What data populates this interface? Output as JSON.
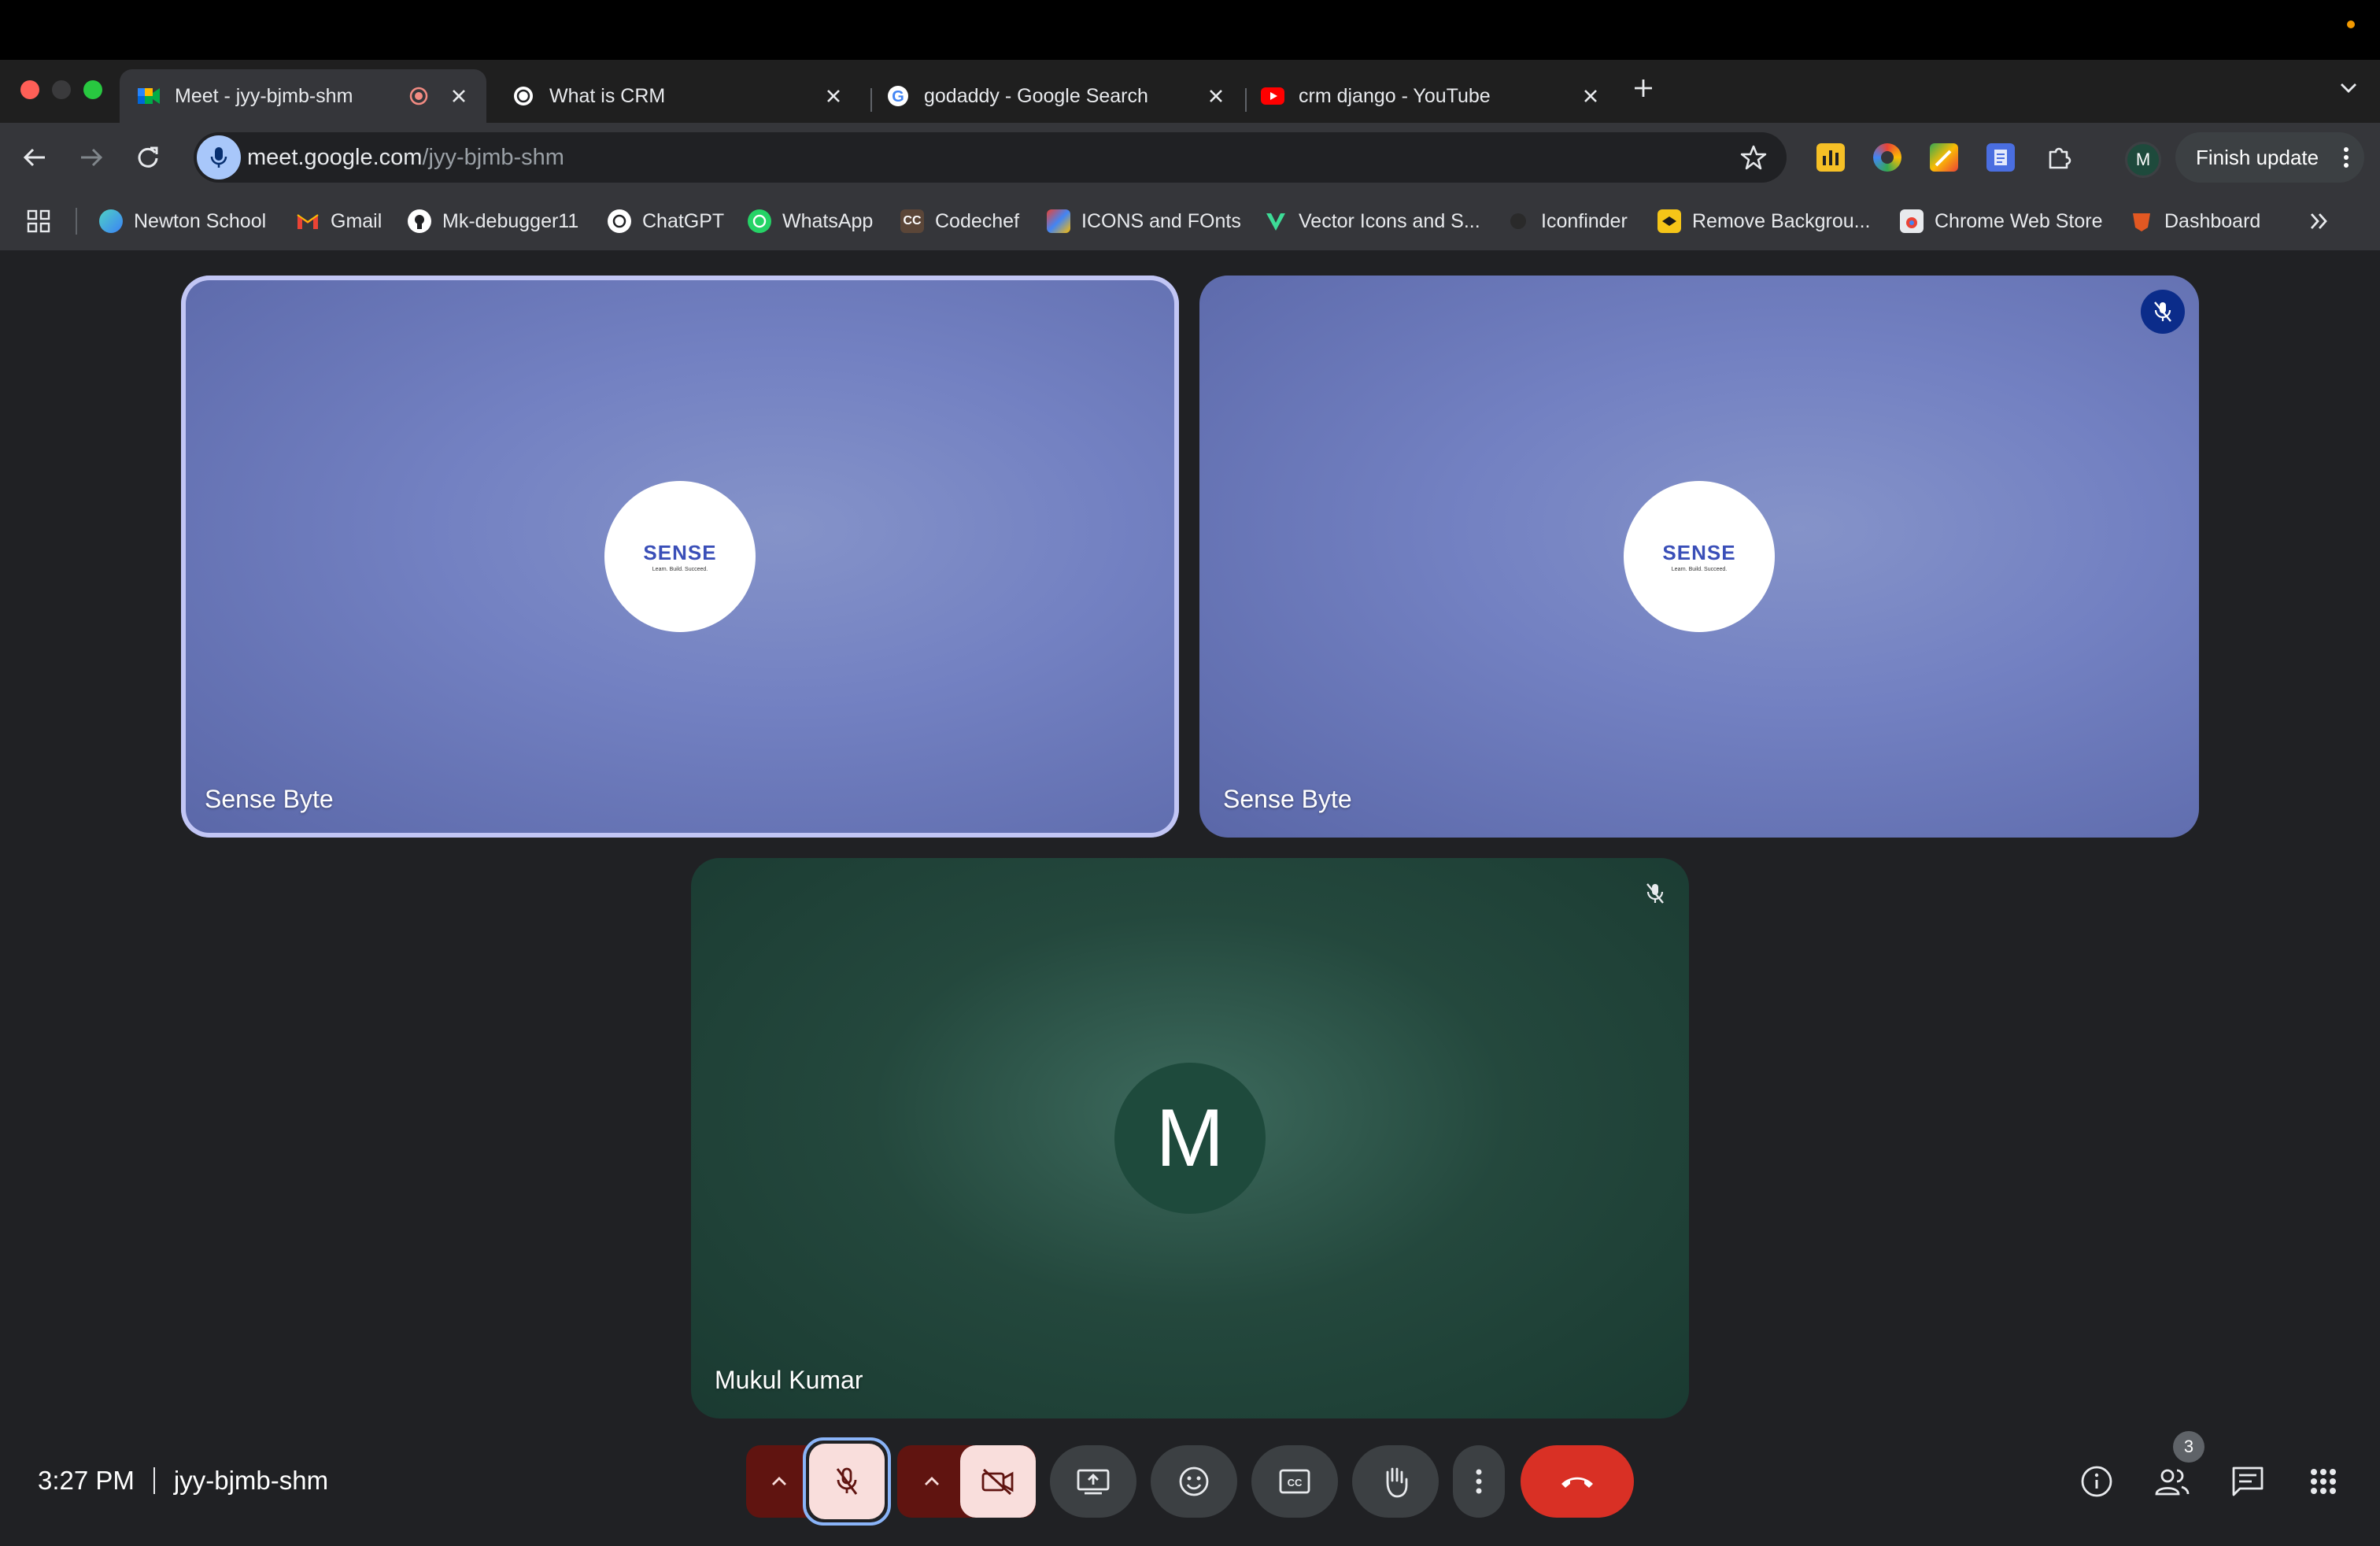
{
  "browser": {
    "tabs": [
      {
        "title": "Meet - jyy-bjmb-shm",
        "favicon": "google-meet-icon",
        "active": true,
        "recording": true
      },
      {
        "title": "What is CRM",
        "favicon": "chatgpt-icon",
        "active": false
      },
      {
        "title": "godaddy - Google Search",
        "favicon": "google-icon",
        "active": false
      },
      {
        "title": "crm django - YouTube",
        "favicon": "youtube-icon",
        "active": false
      }
    ],
    "address": {
      "host": "meet.google.com",
      "path": "/jyy-bjmb-shm"
    },
    "profile_initial": "M",
    "finish_update": "Finish update",
    "bookmarks": [
      {
        "label": "Newton School",
        "icon": "newton-school-icon"
      },
      {
        "label": "Gmail",
        "icon": "gmail-icon"
      },
      {
        "label": "Mk-debugger11",
        "icon": "github-icon"
      },
      {
        "label": "ChatGPT",
        "icon": "chatgpt-icon"
      },
      {
        "label": "WhatsApp",
        "icon": "whatsapp-icon"
      },
      {
        "label": "Codechef",
        "icon": "codechef-icon",
        "mark": "CC"
      },
      {
        "label": "ICONS and FOnts",
        "icon": "icons-fonts-icon"
      },
      {
        "label": "Vector Icons and S...",
        "icon": "vector-icons-icon"
      },
      {
        "label": "Iconfinder",
        "icon": "iconfinder-icon"
      },
      {
        "label": "Remove Backgrou...",
        "icon": "remove-bg-icon"
      },
      {
        "label": "Chrome Web Store",
        "icon": "chrome-web-store-icon"
      },
      {
        "label": "Dashboard",
        "icon": "dashboard-icon"
      }
    ]
  },
  "meet": {
    "tiles": [
      {
        "name": "Sense Byte",
        "logo_text": "SENSE",
        "logo_tagline": "Learn. Build. Succeed.",
        "speaking": true
      },
      {
        "name": "Sense Byte",
        "logo_text": "SENSE",
        "logo_tagline": "Learn. Build. Succeed.",
        "muted": true
      },
      {
        "name": "Mukul Kumar",
        "avatar_initial": "M",
        "muted": true
      }
    ],
    "time": "3:27 PM",
    "meeting_code": "jyy-bjmb-shm",
    "participant_count": "3",
    "colors": {
      "end_call": "#d93025",
      "tile_highlight": "#c2c6f5",
      "muted_control": "#f9dedc",
      "background": "#202124"
    }
  }
}
